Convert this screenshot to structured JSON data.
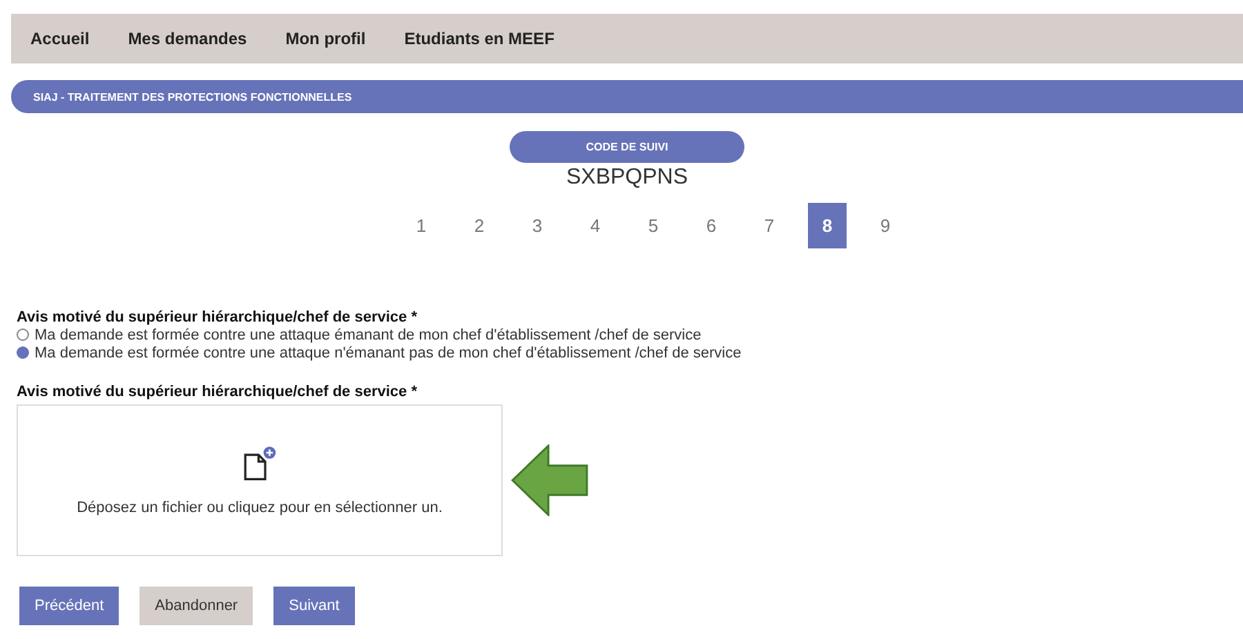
{
  "nav": {
    "items": [
      "Accueil",
      "Mes demandes",
      "Mon profil",
      "Etudiants en MEEF"
    ]
  },
  "banner": {
    "title": "SIAJ - TRAITEMENT DES PROTECTIONS FONCTIONNELLES"
  },
  "tracking": {
    "label": "CODE DE SUIVI",
    "code": "SXBPQPNS"
  },
  "steps": [
    {
      "label": "1",
      "selected": false
    },
    {
      "label": "2",
      "selected": false
    },
    {
      "label": "3",
      "selected": false
    },
    {
      "label": "4",
      "selected": false
    },
    {
      "label": "5",
      "selected": false
    },
    {
      "label": "6",
      "selected": false
    },
    {
      "label": "7",
      "selected": false
    },
    {
      "label": "8",
      "selected": true
    },
    {
      "label": "9",
      "selected": false
    }
  ],
  "question": {
    "label": "Avis motivé du supérieur hiérarchique/chef de service *",
    "options": [
      {
        "label": "Ma demande est formée contre une attaque émanant de mon chef d'établissement /chef de service",
        "selected": false
      },
      {
        "label": "Ma demande est formée contre une attaque n'émanant pas de mon chef d'établissement /chef de service",
        "selected": true
      }
    ]
  },
  "upload": {
    "label": "Avis motivé du supérieur hiérarchique/chef de service *",
    "hint": "Déposez un fichier ou cliquez pour en sélectionner un."
  },
  "buttons": [
    {
      "label": "Précédent",
      "kind": "primary"
    },
    {
      "label": "Abandonner",
      "kind": "secondary"
    },
    {
      "label": "Suivant",
      "kind": "primary"
    }
  ]
}
